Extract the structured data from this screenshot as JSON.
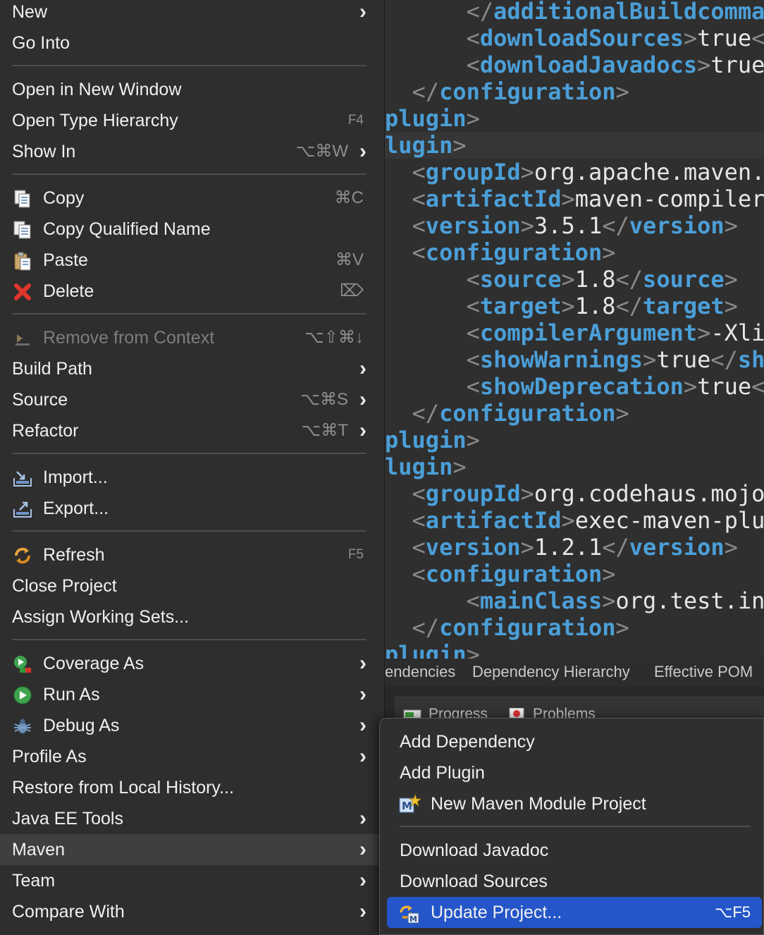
{
  "editor": {
    "lines": [
      {
        "indent": "      ",
        "parts": [
          [
            "p",
            "</"
          ],
          [
            "t",
            "additionalBuildcomma"
          ]
        ]
      },
      {
        "indent": "      ",
        "parts": [
          [
            "p",
            "<"
          ],
          [
            "t",
            "downloadSources"
          ],
          [
            "p",
            ">"
          ],
          [
            "v",
            "true"
          ],
          [
            "p",
            "<"
          ]
        ]
      },
      {
        "indent": "      ",
        "parts": [
          [
            "p",
            "<"
          ],
          [
            "t",
            "downloadJavadocs"
          ],
          [
            "p",
            ">"
          ],
          [
            "v",
            "true"
          ]
        ]
      },
      {
        "indent": "  ",
        "parts": [
          [
            "p",
            "</"
          ],
          [
            "t",
            "configuration"
          ],
          [
            "p",
            ">"
          ]
        ]
      },
      {
        "indent": "",
        "parts": [
          [
            "t",
            "plugin"
          ],
          [
            "p",
            ">"
          ]
        ]
      },
      {
        "indent": "",
        "parts": [
          [
            "t",
            "lugin"
          ],
          [
            "p",
            ">"
          ]
        ]
      },
      {
        "indent": "  ",
        "parts": [
          [
            "p",
            "<"
          ],
          [
            "t",
            "groupId"
          ],
          [
            "p",
            ">"
          ],
          [
            "v",
            "org.apache.maven."
          ]
        ]
      },
      {
        "indent": "  ",
        "parts": [
          [
            "p",
            "<"
          ],
          [
            "t",
            "artifactId"
          ],
          [
            "p",
            ">"
          ],
          [
            "v",
            "maven-compiler"
          ]
        ]
      },
      {
        "indent": "  ",
        "parts": [
          [
            "p",
            "<"
          ],
          [
            "t",
            "version"
          ],
          [
            "p",
            ">"
          ],
          [
            "v",
            "3.5.1"
          ],
          [
            "p",
            "</"
          ],
          [
            "t",
            "version"
          ],
          [
            "p",
            ">"
          ]
        ]
      },
      {
        "indent": "  ",
        "parts": [
          [
            "p",
            "<"
          ],
          [
            "t",
            "configuration"
          ],
          [
            "p",
            ">"
          ]
        ]
      },
      {
        "indent": "      ",
        "parts": [
          [
            "p",
            "<"
          ],
          [
            "t",
            "source"
          ],
          [
            "p",
            ">"
          ],
          [
            "v",
            "1.8"
          ],
          [
            "p",
            "</"
          ],
          [
            "t",
            "source"
          ],
          [
            "p",
            ">"
          ]
        ]
      },
      {
        "indent": "      ",
        "parts": [
          [
            "p",
            "<"
          ],
          [
            "t",
            "target"
          ],
          [
            "p",
            ">"
          ],
          [
            "v",
            "1.8"
          ],
          [
            "p",
            "</"
          ],
          [
            "t",
            "target"
          ],
          [
            "p",
            ">"
          ]
        ]
      },
      {
        "indent": "      ",
        "parts": [
          [
            "p",
            "<"
          ],
          [
            "t",
            "compilerArgument"
          ],
          [
            "p",
            ">"
          ],
          [
            "v",
            "-Xli"
          ]
        ]
      },
      {
        "indent": "      ",
        "parts": [
          [
            "p",
            "<"
          ],
          [
            "t",
            "showWarnings"
          ],
          [
            "p",
            ">"
          ],
          [
            "v",
            "true"
          ],
          [
            "p",
            "</"
          ],
          [
            "t",
            "sh"
          ]
        ]
      },
      {
        "indent": "      ",
        "parts": [
          [
            "p",
            "<"
          ],
          [
            "t",
            "showDeprecation"
          ],
          [
            "p",
            ">"
          ],
          [
            "v",
            "true"
          ],
          [
            "p",
            "<"
          ]
        ]
      },
      {
        "indent": "  ",
        "parts": [
          [
            "p",
            "</"
          ],
          [
            "t",
            "configuration"
          ],
          [
            "p",
            ">"
          ]
        ]
      },
      {
        "indent": "",
        "parts": [
          [
            "t",
            "plugin"
          ],
          [
            "p",
            ">"
          ]
        ]
      },
      {
        "indent": "",
        "parts": [
          [
            "t",
            "lugin"
          ],
          [
            "p",
            ">"
          ]
        ]
      },
      {
        "indent": "  ",
        "parts": [
          [
            "p",
            "<"
          ],
          [
            "t",
            "groupId"
          ],
          [
            "p",
            ">"
          ],
          [
            "v",
            "org.codehaus.mojo"
          ]
        ]
      },
      {
        "indent": "  ",
        "parts": [
          [
            "p",
            "<"
          ],
          [
            "t",
            "artifactId"
          ],
          [
            "p",
            ">"
          ],
          [
            "v",
            "exec-maven-plu"
          ]
        ]
      },
      {
        "indent": "  ",
        "parts": [
          [
            "p",
            "<"
          ],
          [
            "t",
            "version"
          ],
          [
            "p",
            ">"
          ],
          [
            "v",
            "1.2.1"
          ],
          [
            "p",
            "</"
          ],
          [
            "t",
            "version"
          ],
          [
            "p",
            ">"
          ]
        ]
      },
      {
        "indent": "  ",
        "parts": [
          [
            "p",
            "<"
          ],
          [
            "t",
            "configuration"
          ],
          [
            "p",
            ">"
          ]
        ]
      },
      {
        "indent": "      ",
        "parts": [
          [
            "p",
            "<"
          ],
          [
            "t",
            "mainClass"
          ],
          [
            "p",
            ">"
          ],
          [
            "v",
            "org.test.in"
          ]
        ]
      },
      {
        "indent": "  ",
        "parts": [
          [
            "p",
            "</"
          ],
          [
            "t",
            "configuration"
          ],
          [
            "p",
            ">"
          ]
        ]
      },
      {
        "indent": "",
        "parts": [
          [
            "t",
            "plugin"
          ],
          [
            "p",
            ">"
          ]
        ]
      }
    ]
  },
  "pom_tabs": [
    "endencies",
    "Dependency Hierarchy",
    "Effective POM"
  ],
  "views": {
    "progress": "Progress",
    "problems": "Problems"
  },
  "main_menu": {
    "new": "New",
    "go_into": "Go Into",
    "open_in_new_window": "Open in New Window",
    "open_type_hierarchy": "Open Type Hierarchy",
    "open_type_hierarchy_sc": "F4",
    "show_in": "Show In",
    "show_in_sc": "⌥⌘W",
    "copy": "Copy",
    "copy_sc": "⌘C",
    "copy_qualified_name": "Copy Qualified Name",
    "paste": "Paste",
    "paste_sc": "⌘V",
    "delete": "Delete",
    "delete_sc": "⌦",
    "remove_from_context": "Remove from Context",
    "remove_from_context_sc": "⌥⇧⌘↓",
    "build_path": "Build Path",
    "source": "Source",
    "source_sc": "⌥⌘S",
    "refactor": "Refactor",
    "refactor_sc": "⌥⌘T",
    "import": "Import...",
    "export": "Export...",
    "refresh": "Refresh",
    "refresh_sc": "F5",
    "close_project": "Close Project",
    "assign_working_sets": "Assign Working Sets...",
    "coverage_as": "Coverage As",
    "run_as": "Run As",
    "debug_as": "Debug As",
    "profile_as": "Profile As",
    "restore_from_local_history": "Restore from Local History...",
    "java_ee_tools": "Java EE Tools",
    "maven": "Maven",
    "team": "Team",
    "compare_with": "Compare With",
    "submenu_arrow": "›"
  },
  "maven_menu": {
    "add_dependency": "Add Dependency",
    "add_plugin": "Add Plugin",
    "new_maven_module_project": "New Maven Module Project",
    "download_javadoc": "Download Javadoc",
    "download_sources": "Download Sources",
    "update_project": "Update Project...",
    "update_project_sc": "⌥F5"
  },
  "colors": {
    "xml_tag": "#4b9fd8",
    "menu_bg": "#2e2e2e",
    "selection_blue": "#2456c9",
    "hover_gray": "#3f3f3f",
    "delete_red": "#e0352b"
  }
}
